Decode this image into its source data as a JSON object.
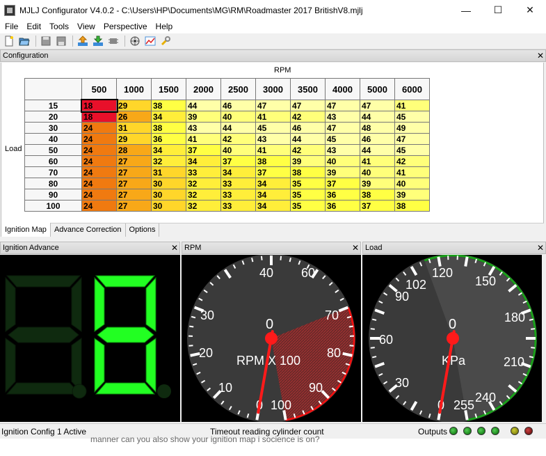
{
  "window": {
    "title": "MJLJ Configurator V4.0.2 - C:\\Users\\HP\\Documents\\MG\\RM\\Roadmaster 2017 BritishV8.mjlj",
    "minimize": "—",
    "maximize": "☐",
    "close": "✕"
  },
  "menu": [
    "File",
    "Edit",
    "Tools",
    "View",
    "Perspective",
    "Help"
  ],
  "toolbar_icons": [
    "new-file-icon",
    "open-folder-icon",
    "save-icon",
    "save-as-icon",
    "upload-icon",
    "download-icon",
    "chip-icon",
    "settings-wheel-icon",
    "chart-icon",
    "wrench-icon"
  ],
  "config": {
    "title": "Configuration",
    "close": "✕",
    "axis_x_label": "RPM",
    "axis_y_label": "Load",
    "columns": [
      "500",
      "1000",
      "1500",
      "2000",
      "2500",
      "3000",
      "3500",
      "4000",
      "5000",
      "6000"
    ],
    "rows": [
      {
        "load": "15",
        "values": [
          "18",
          "29",
          "38",
          "44",
          "46",
          "47",
          "47",
          "47",
          "47",
          "41"
        ]
      },
      {
        "load": "20",
        "values": [
          "18",
          "26",
          "34",
          "39",
          "40",
          "41",
          "42",
          "43",
          "44",
          "45"
        ]
      },
      {
        "load": "30",
        "values": [
          "24",
          "31",
          "38",
          "43",
          "44",
          "45",
          "46",
          "47",
          "48",
          "49"
        ]
      },
      {
        "load": "40",
        "values": [
          "24",
          "29",
          "36",
          "41",
          "42",
          "43",
          "44",
          "45",
          "46",
          "47"
        ]
      },
      {
        "load": "50",
        "values": [
          "24",
          "28",
          "34",
          "37",
          "40",
          "41",
          "42",
          "43",
          "44",
          "45"
        ]
      },
      {
        "load": "60",
        "values": [
          "24",
          "27",
          "32",
          "34",
          "37",
          "38",
          "39",
          "40",
          "41",
          "42"
        ]
      },
      {
        "load": "70",
        "values": [
          "24",
          "27",
          "31",
          "33",
          "34",
          "37",
          "38",
          "39",
          "40",
          "41"
        ]
      },
      {
        "load": "80",
        "values": [
          "24",
          "27",
          "30",
          "32",
          "33",
          "34",
          "35",
          "37",
          "39",
          "40"
        ]
      },
      {
        "load": "90",
        "values": [
          "24",
          "27",
          "30",
          "32",
          "33",
          "34",
          "35",
          "36",
          "38",
          "39"
        ]
      },
      {
        "load": "100",
        "values": [
          "24",
          "27",
          "30",
          "32",
          "33",
          "34",
          "35",
          "36",
          "37",
          "38"
        ]
      }
    ]
  },
  "tabs": [
    "Ignition Map",
    "Advance Correction",
    "Options"
  ],
  "panes": {
    "ignition": {
      "title": "Ignition Advance",
      "close": "✕"
    },
    "rpm": {
      "title": "RPM",
      "close": "✕",
      "value": "0",
      "unit": "RPM X 100",
      "min_label": "0",
      "max_label": "100",
      "ticks": [
        "10",
        "20",
        "30",
        "40",
        "60",
        "70",
        "80",
        "90"
      ]
    },
    "load": {
      "title": "Load",
      "close": "✕",
      "value": "0",
      "unit": "KPa",
      "min_label": "0",
      "max_label": "255",
      "ticks": [
        "30",
        "60",
        "90",
        "102",
        "120",
        "150",
        "180",
        "210",
        "240"
      ]
    }
  },
  "status": {
    "left": "Ignition Config 1 Active",
    "center": "Timeout reading cylinder count",
    "outputs": "Outputs",
    "bottom_fragment": "manner can you also show your ignition map i socience is on?"
  },
  "colors": {
    "cell_red": "#e8102a",
    "cell_orange": "#f07a10",
    "cell_yellow": "#ffff44",
    "seg_on": "#22ff22",
    "seg_off": "#0f2a0f",
    "gauge_bg": "#3a3a3a",
    "needle": "#ff1a1a"
  }
}
